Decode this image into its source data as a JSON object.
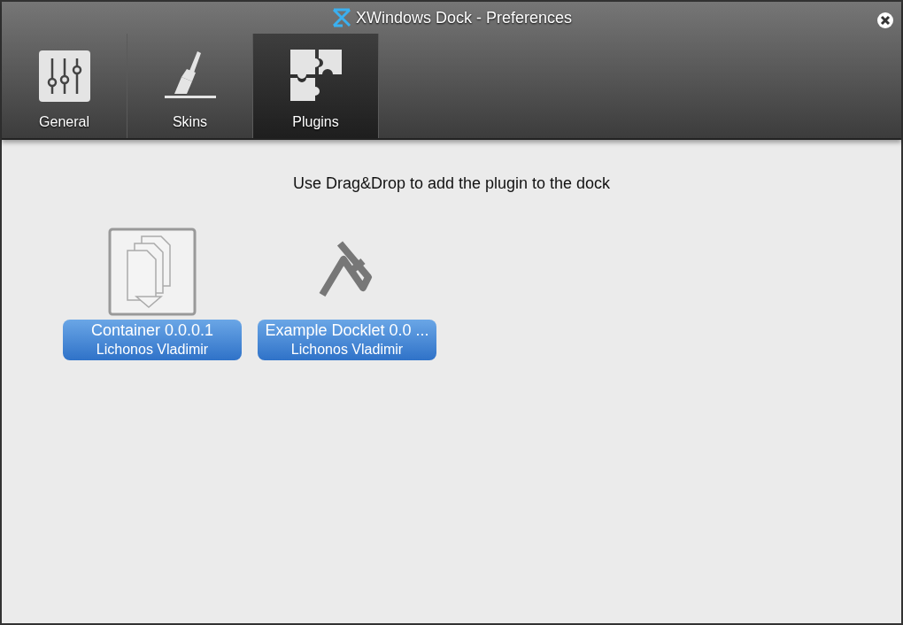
{
  "window": {
    "title": "XWindows Dock - Preferences"
  },
  "tabs": [
    {
      "label": "General",
      "kind": "sliders",
      "selected": false
    },
    {
      "label": "Skins",
      "kind": "brush",
      "selected": false
    },
    {
      "label": "Plugins",
      "kind": "puzzle",
      "selected": true
    }
  ],
  "instruction": "Use Drag&Drop to add the plugin to the dock",
  "plugins": [
    {
      "name": "Container 0.0.0.1",
      "author": "Lichonos Vladimir",
      "kind": "container",
      "selected": false
    },
    {
      "name": "Example Docklet 0.0 ...",
      "author": "Lichonos Vladimir",
      "kind": "docklet",
      "selected": false
    }
  ]
}
